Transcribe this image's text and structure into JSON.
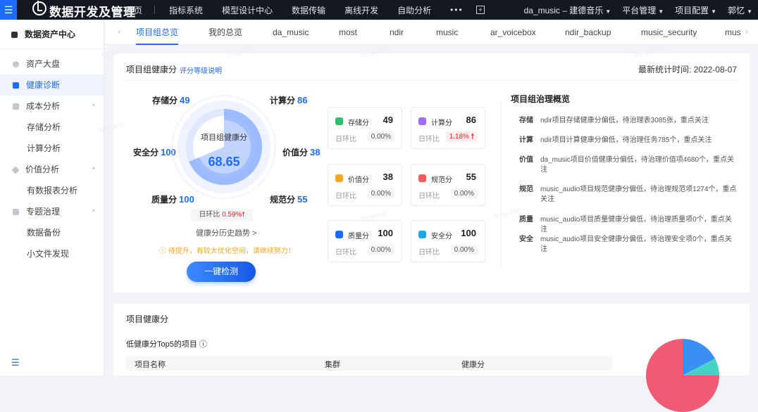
{
  "header": {
    "brand": "数据开发及管理",
    "nav": [
      "首页",
      "指标系统",
      "模型设计中心",
      "数据传输",
      "离线开发",
      "自助分析"
    ],
    "more": "•••",
    "project": "da_music – 建德音乐",
    "platform": "平台管理",
    "config": "项目配置",
    "user": "郭忆"
  },
  "sidebar": {
    "title": "数据资产中心",
    "items": [
      {
        "label": "资产大盘"
      },
      {
        "label": "健康诊断"
      },
      {
        "label": "成本分析"
      },
      {
        "label": "存储分析"
      },
      {
        "label": "计算分析"
      },
      {
        "label": "价值分析"
      },
      {
        "label": "有数报表分析"
      },
      {
        "label": "专题治理"
      },
      {
        "label": "数据备份"
      },
      {
        "label": "小文件发现"
      }
    ]
  },
  "tabs": [
    "项目组总览",
    "我的总览",
    "da_music",
    "most",
    "ndir",
    "music",
    "ar_voicebox",
    "ndir_backup",
    "music_security",
    "mus"
  ],
  "health": {
    "title": "项目组健康分",
    "rating_link": "评分等级说明",
    "date": "最新统计时间: 2022-08-07",
    "storage_label": "存储分",
    "storage": "49",
    "compute_label": "计算分",
    "compute": "86",
    "security_label": "安全分",
    "security": "100",
    "value_label": "价值分",
    "value": "38",
    "quality_label": "质量分",
    "quality": "100",
    "norm_label": "规范分",
    "norm": "55",
    "center_label": "项目组健康分",
    "center_value": "68.65",
    "center_fraction": 0.6865,
    "dod_label": "日环比",
    "dod_value": "0.59%",
    "history": "健康分历史趋势 >",
    "tip": "待提升，有较大优化空间，请继续努力！",
    "button": "一键检测"
  },
  "score_cards": [
    {
      "name": "存储分",
      "value": "49",
      "dod_label": "日环比",
      "dod": "0.00%",
      "color": "#2bbf6a",
      "up": false
    },
    {
      "name": "计算分",
      "value": "86",
      "dod_label": "日环比",
      "dod": "1.18%",
      "color": "#9b6ef3",
      "up": true
    },
    {
      "name": "价值分",
      "value": "38",
      "dod_label": "日环比",
      "dod": "0.00%",
      "color": "#f5a623",
      "up": false
    },
    {
      "name": "规范分",
      "value": "55",
      "dod_label": "日环比",
      "dod": "0.00%",
      "color": "#f25b5b",
      "up": false
    },
    {
      "name": "质量分",
      "value": "100",
      "dod_label": "日环比",
      "dod": "0.00%",
      "color": "#1e6cff",
      "up": false
    },
    {
      "name": "安全分",
      "value": "100",
      "dod_label": "日环比",
      "dod": "0.00%",
      "color": "#1fa6e8",
      "up": false
    }
  ],
  "governance": {
    "title": "项目组治理概览",
    "items": [
      {
        "tag": "存储",
        "text": "ndir项目存储健康分偏低，待治理表3085张，重点关注"
      },
      {
        "tag": "计算",
        "text": "ndir项目计算健康分偏低，待治理任务785个，重点关注"
      },
      {
        "tag": "价值",
        "text": "da_music项目价值健康分偏低，待治理价值项4680个，重点关注"
      },
      {
        "tag": "规范",
        "text": "music_audio项目规范健康分偏低，待治理规范项1274个，重点关注"
      },
      {
        "tag": "质量",
        "text": "music_audio项目质量健康分偏低，待治理质量项0个，重点关注"
      },
      {
        "tag": "安全",
        "text": "music_audio项目安全健康分偏低，待治理安全项0个，重点关注"
      }
    ]
  },
  "project_health": {
    "title": "项目健康分",
    "subtitle": "低健康分Top5的项目",
    "columns": [
      "项目名称",
      "集群",
      "健康分"
    ]
  },
  "watermark": "fenguoyi"
}
